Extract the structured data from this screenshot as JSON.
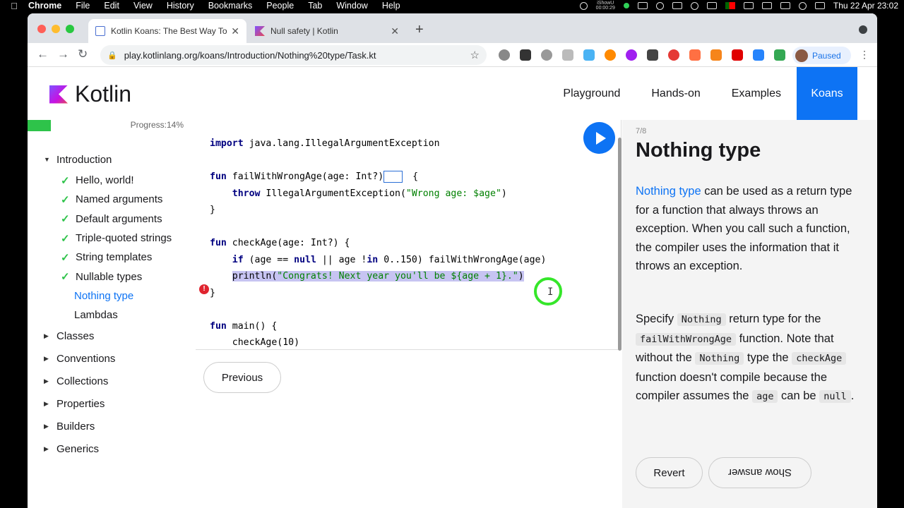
{
  "menubar": {
    "app": "Chrome",
    "items": [
      "File",
      "Edit",
      "View",
      "History",
      "Bookmarks",
      "People",
      "Tab",
      "Window",
      "Help"
    ],
    "recorder_label": "iShowU",
    "recorder_time": "00:00:29",
    "datetime": "Thu 22 Apr  23:02"
  },
  "browser": {
    "tabs": [
      {
        "title": "Kotlin Koans: The Best Way To",
        "active": true
      },
      {
        "title": "Null safety | Kotlin",
        "active": false
      }
    ],
    "url": "play.kotlinlang.org/koans/Introduction/Nothing%20type/Task.kt",
    "profile_label": "Paused"
  },
  "site": {
    "logo_text": "Kotlin",
    "nav": [
      "Playground",
      "Hands-on",
      "Examples",
      "Koans"
    ],
    "nav_active": "Koans"
  },
  "sidebar": {
    "progress_text": "Progress:14%",
    "progress_value": 0.14,
    "sections": [
      {
        "label": "Introduction",
        "expanded": true,
        "items": [
          {
            "label": "Hello, world!",
            "done": true
          },
          {
            "label": "Named arguments",
            "done": true
          },
          {
            "label": "Default arguments",
            "done": true
          },
          {
            "label": "Triple-quoted strings",
            "done": true
          },
          {
            "label": "String templates",
            "done": true
          },
          {
            "label": "Nullable types",
            "done": true
          },
          {
            "label": "Nothing type",
            "done": false,
            "current": true
          },
          {
            "label": "Lambdas",
            "done": false
          }
        ]
      },
      {
        "label": "Classes",
        "expanded": false
      },
      {
        "label": "Conventions",
        "expanded": false
      },
      {
        "label": "Collections",
        "expanded": false
      },
      {
        "label": "Properties",
        "expanded": false
      },
      {
        "label": "Builders",
        "expanded": false
      },
      {
        "label": "Generics",
        "expanded": false
      }
    ]
  },
  "editor": {
    "lines": {
      "l1_kw": "import",
      "l1_rest": " java.lang.IllegalArgumentException",
      "l3_kw": "fun",
      "l3_a": " failWithWrongAge(age: Int?)",
      "l3_b": " {",
      "l4_kw": "throw",
      "l4_a": " IllegalArgumentException(",
      "l4_str": "\"Wrong age: $age\"",
      "l4_b": ")",
      "l5": "}",
      "l7_kw": "fun",
      "l7_rest": " checkAge(age: Int?) {",
      "l8_kw1": "if",
      "l8_a": " (age == ",
      "l8_kw2": "null",
      "l8_b": " || age !",
      "l8_kw3": "in",
      "l8_c": " 0..150) failWithWrongAge(age)",
      "l9_a": "println(",
      "l9_str": "\"Congrats! Next year you'll be ${age + 1}.\"",
      "l9_b": ")",
      "l10": "}",
      "l12_kw": "fun",
      "l12_rest": " main() {",
      "l13": "checkAge(10)"
    }
  },
  "buttons": {
    "previous": "Previous",
    "revert": "Revert",
    "show_answer": "Show answer"
  },
  "task": {
    "counter": "7/8",
    "title": "Nothing type",
    "p1_link": "Nothing type",
    "p1_text": " can be used as a return type for a function that always throws an exception. When you call such a function, the compiler uses the information that it throws an exception.",
    "p2_a": "Specify ",
    "p2_code1": "Nothing",
    "p2_b": " return type for the ",
    "p2_code2": "failWithWrongAge",
    "p2_c": " function. Note that without the ",
    "p2_code3": "Nothing",
    "p2_d": " type the ",
    "p2_code4": "checkAge",
    "p2_e": " function doesn't compile because the compiler assumes the ",
    "p2_code5": "age",
    "p2_f": " can be ",
    "p2_code6": "null",
    "p2_g": "."
  },
  "colors": {
    "accent": "#0d73f4",
    "progress": "#2ec34a",
    "error": "#e0242f",
    "highlight": "#c7c4f2"
  }
}
